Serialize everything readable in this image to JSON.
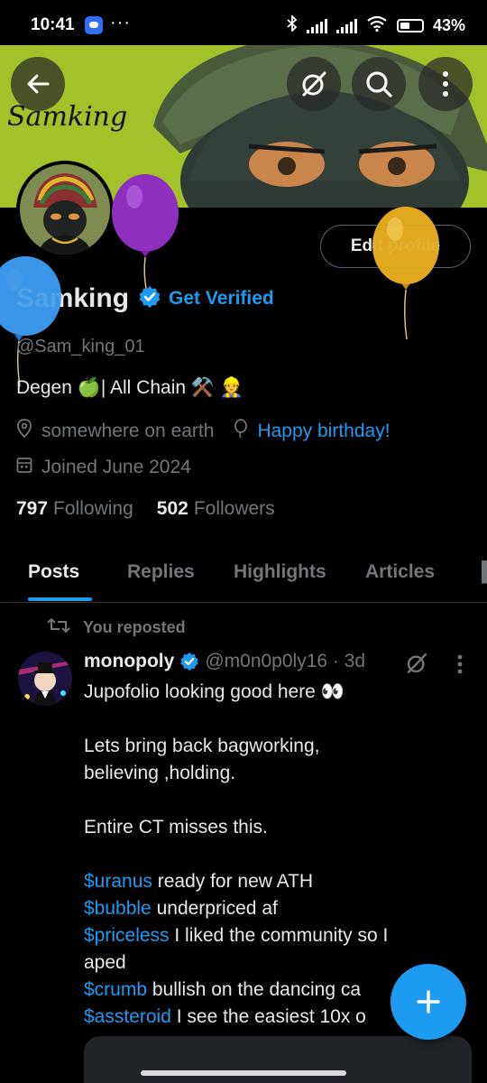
{
  "status_bar": {
    "time": "10:41",
    "dots": "···",
    "battery": "43%"
  },
  "banner": {
    "script_text": "Samking"
  },
  "profile": {
    "edit_label": "Edit profile",
    "name": "Samking",
    "get_verified": "Get Verified",
    "handle": "@Sam_king_01",
    "bio": "Degen 🍏| All Chain ⚒️ 👷",
    "location": "somewhere on earth",
    "birthday": "Happy birthday!",
    "joined": "Joined June 2024",
    "following_count": "797",
    "following_label": "Following",
    "followers_count": "502",
    "followers_label": "Followers"
  },
  "tabs": [
    "Posts",
    "Replies",
    "Highlights",
    "Articles"
  ],
  "post": {
    "repost_label": "You reposted",
    "author": "monopoly",
    "handle_time": "@m0n0p0ly16 · 3d",
    "line1": "Jupofolio looking good here 👀",
    "line2": "Lets bring back bagworking,",
    "line3": "believing ,holding.",
    "line4": "Entire CT misses this.",
    "t1": "$uranus",
    "t1_text": " ready for new ATH",
    "t2": "$bubble",
    "t2_text": " underpriced af",
    "t3": "$priceless",
    "t3_text": " I liked the community so I",
    "t3_cont": "aped",
    "t4": "$crumb",
    "t4_text": " bullish on the dancing ca",
    "t5": "$assteroid",
    "t5_text": " I see the easiest 10x o"
  },
  "colors": {
    "accent": "#1d9bf0",
    "banner": "#a8c52c",
    "muted": "#71767b"
  }
}
